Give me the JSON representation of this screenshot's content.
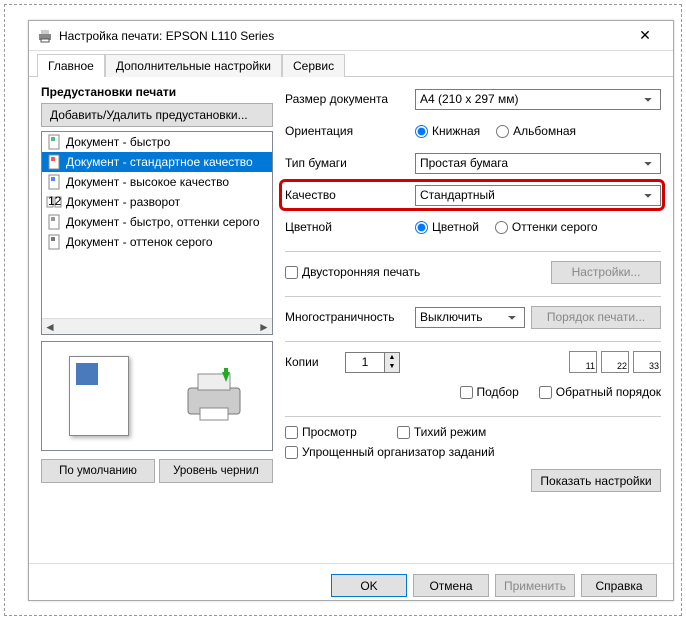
{
  "window": {
    "title": "Настройка печати: EPSON L110 Series"
  },
  "tabs": {
    "main": "Главное",
    "advanced": "Дополнительные настройки",
    "service": "Сервис"
  },
  "left": {
    "heading": "Предустановки печати",
    "addRemove": "Добавить/Удалить предустановки...",
    "presets": [
      "Документ - быстро",
      "Документ - стандартное качество",
      "Документ - высокое качество",
      "Документ - разворот",
      "Документ - быстро, оттенки серого",
      "Документ - оттенок серого"
    ],
    "defaultBtn": "По умолчанию",
    "inkBtn": "Уровень чернил"
  },
  "right": {
    "docSize": {
      "label": "Размер документа",
      "value": "A4 (210 x 297 мм)"
    },
    "orientation": {
      "label": "Ориентация",
      "portrait": "Книжная",
      "landscape": "Альбомная"
    },
    "paperType": {
      "label": "Тип бумаги",
      "value": "Простая бумага"
    },
    "quality": {
      "label": "Качество",
      "value": "Стандартный"
    },
    "color": {
      "label": "Цветной",
      "colorOpt": "Цветной",
      "grayOpt": "Оттенки серого"
    },
    "duplex": {
      "label": "Двусторонняя печать",
      "settingsBtn": "Настройки..."
    },
    "multipage": {
      "label": "Многостраничность",
      "value": "Выключить",
      "orderBtn": "Порядок печати..."
    },
    "copies": {
      "label": "Копии",
      "value": "1",
      "i1": "11",
      "i2": "22",
      "i3": "33",
      "collate": "Подбор",
      "reverse": "Обратный порядок"
    },
    "previewChk": "Просмотр",
    "quietChk": "Тихий режим",
    "simpleOrgChk": "Упрощенный организатор заданий",
    "showSettings": "Показать настройки"
  },
  "buttons": {
    "ok": "OK",
    "cancel": "Отмена",
    "apply": "Применить",
    "help": "Справка"
  }
}
